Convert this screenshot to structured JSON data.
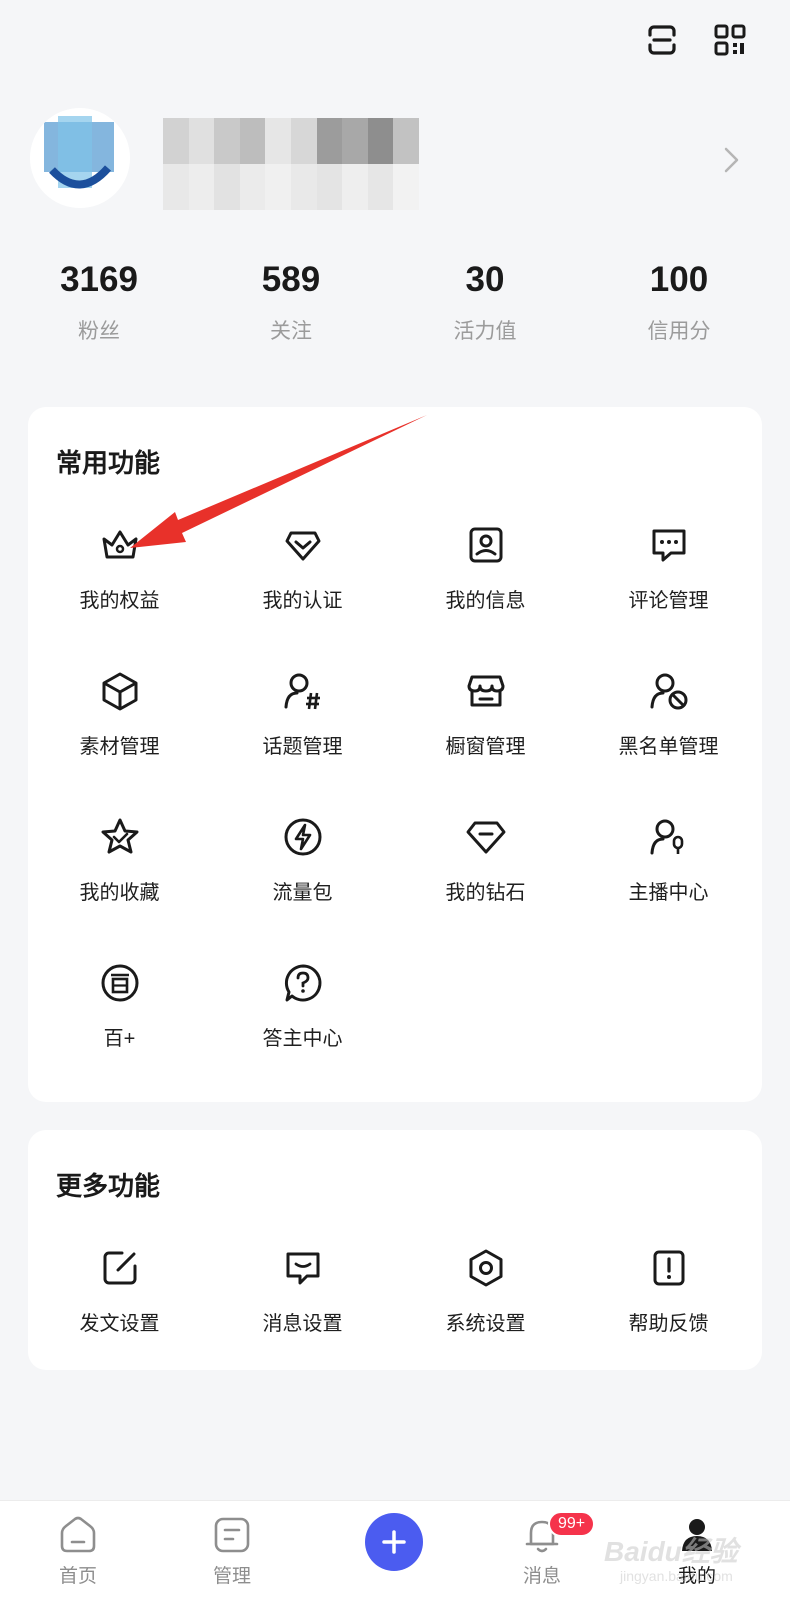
{
  "header": {
    "scan_icon": "scan-icon",
    "qrcode_icon": "qrcode-icon"
  },
  "profile": {
    "avatar_icon": "avatar",
    "name_redacted": true,
    "chevron_icon": "chevron-right-icon"
  },
  "stats": [
    {
      "value": "3169",
      "label": "粉丝"
    },
    {
      "value": "589",
      "label": "关注"
    },
    {
      "value": "30",
      "label": "活力值"
    },
    {
      "value": "100",
      "label": "信用分"
    }
  ],
  "common_functions": {
    "title": "常用功能",
    "items": [
      {
        "label": "我的权益",
        "icon": "crown-icon"
      },
      {
        "label": "我的认证",
        "icon": "verify-icon"
      },
      {
        "label": "我的信息",
        "icon": "profile-card-icon"
      },
      {
        "label": "评论管理",
        "icon": "comment-icon"
      },
      {
        "label": "素材管理",
        "icon": "cube-icon"
      },
      {
        "label": "话题管理",
        "icon": "topic-icon"
      },
      {
        "label": "橱窗管理",
        "icon": "store-icon"
      },
      {
        "label": "黑名单管理",
        "icon": "block-user-icon"
      },
      {
        "label": "我的收藏",
        "icon": "star-icon"
      },
      {
        "label": "流量包",
        "icon": "lightning-icon"
      },
      {
        "label": "我的钻石",
        "icon": "diamond-icon"
      },
      {
        "label": "主播中心",
        "icon": "streamer-icon"
      },
      {
        "label": "百+",
        "icon": "bai-plus-icon"
      },
      {
        "label": "答主中心",
        "icon": "question-icon"
      }
    ]
  },
  "more_functions": {
    "title": "更多功能",
    "items": [
      {
        "label": "发文设置",
        "icon": "edit-icon"
      },
      {
        "label": "消息设置",
        "icon": "message-icon"
      },
      {
        "label": "系统设置",
        "icon": "settings-icon"
      },
      {
        "label": "帮助反馈",
        "icon": "feedback-icon"
      }
    ]
  },
  "tabbar": {
    "tabs": [
      {
        "label": "首页",
        "icon": "home-icon"
      },
      {
        "label": "管理",
        "icon": "manage-icon"
      },
      {
        "label": "",
        "icon": "plus-icon"
      },
      {
        "label": "消息",
        "icon": "bell-icon",
        "badge": "99+"
      },
      {
        "label": "我的",
        "icon": "user-icon"
      }
    ]
  },
  "watermark": {
    "line1": "Baidu经验",
    "line2": "jingyan.baidu.com"
  },
  "colors": {
    "accent": "#4b5cf0",
    "badge": "#f5334b",
    "arrow": "#e8312a",
    "background": "#f5f6f8"
  }
}
